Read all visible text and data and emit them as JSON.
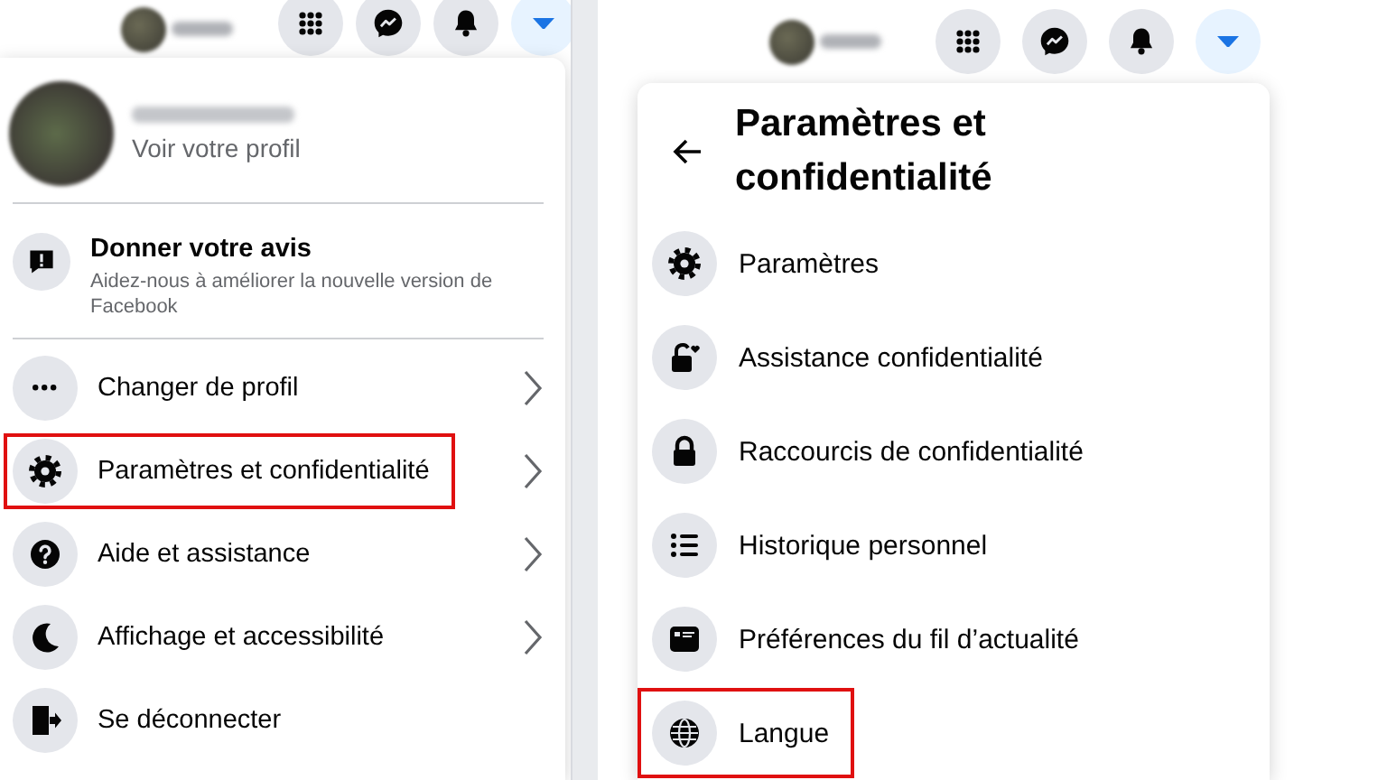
{
  "left": {
    "top_bar": {
      "buttons": [
        {
          "kind": "grid",
          "selected": false
        },
        {
          "kind": "messenger",
          "selected": false
        },
        {
          "kind": "bell",
          "selected": false
        },
        {
          "kind": "caret",
          "selected": true
        }
      ]
    },
    "menu": {
      "profile": {
        "subtitle": "Voir votre profil"
      },
      "feedback": {
        "title": "Donner votre avis",
        "description": "Aidez-nous à améliorer la nouvelle version de Facebook"
      },
      "items": [
        {
          "kind": "dots",
          "label": "Changer de profil",
          "has_submenu": true,
          "highlighted": false
        },
        {
          "kind": "gear",
          "label": "Paramètres et confidentialité",
          "has_submenu": true,
          "highlighted": true
        },
        {
          "kind": "question",
          "label": "Aide et assistance",
          "has_submenu": true,
          "highlighted": false
        },
        {
          "kind": "moon",
          "label": "Affichage et accessibilité",
          "has_submenu": true,
          "highlighted": false
        },
        {
          "kind": "exit",
          "label": "Se déconnecter",
          "has_submenu": false,
          "highlighted": false
        }
      ]
    }
  },
  "right": {
    "top_bar": {
      "buttons": [
        {
          "kind": "grid",
          "selected": false
        },
        {
          "kind": "messenger",
          "selected": false
        },
        {
          "kind": "bell",
          "selected": false
        },
        {
          "kind": "caret",
          "selected": true
        }
      ]
    },
    "panel": {
      "title": "Paramètres et confidentialité",
      "items": [
        {
          "kind": "gear",
          "label": "Paramètres",
          "highlighted": false
        },
        {
          "kind": "lock-heart",
          "label": "Assistance confidentialité",
          "highlighted": false
        },
        {
          "kind": "lock",
          "label": "Raccourcis de confidentialité",
          "highlighted": false
        },
        {
          "kind": "list",
          "label": "Historique personnel",
          "highlighted": false
        },
        {
          "kind": "feed",
          "label": "Préférences du fil d’actualité",
          "highlighted": false
        },
        {
          "kind": "globe",
          "label": "Langue",
          "highlighted": true
        }
      ]
    }
  }
}
